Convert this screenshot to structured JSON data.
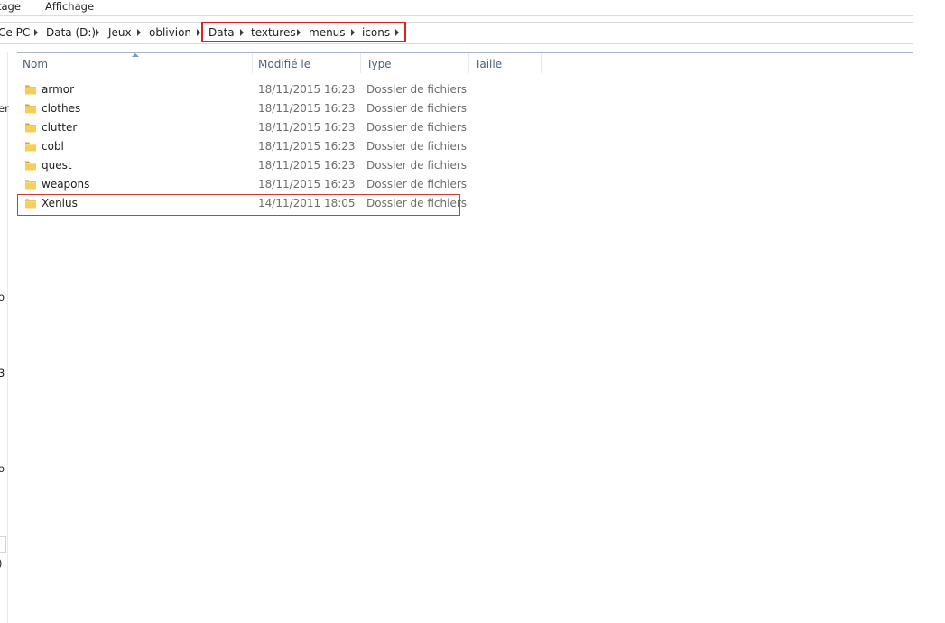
{
  "ribbon": {
    "tabs": [
      "tage",
      "Affichage"
    ]
  },
  "address": {
    "crumbs": [
      "Ce PC",
      "Data (D:)",
      "Jeux",
      "oblivion",
      "Data",
      "textures",
      "menus",
      "icons"
    ]
  },
  "left_pane": {
    "fragments": [
      "er",
      "o",
      "3",
      "o",
      ")"
    ]
  },
  "columns": {
    "name": "Nom",
    "modified": "Modifié le",
    "type": "Type",
    "size": "Taille"
  },
  "files": [
    {
      "name": "armor",
      "modified": "18/11/2015 16:23",
      "type": "Dossier de fichiers",
      "icon": "folder-icon"
    },
    {
      "name": "clothes",
      "modified": "18/11/2015 16:23",
      "type": "Dossier de fichiers",
      "icon": "folder-icon"
    },
    {
      "name": "clutter",
      "modified": "18/11/2015 16:23",
      "type": "Dossier de fichiers",
      "icon": "folder-icon"
    },
    {
      "name": "cobl",
      "modified": "18/11/2015 16:23",
      "type": "Dossier de fichiers",
      "icon": "folder-icon"
    },
    {
      "name": "quest",
      "modified": "18/11/2015 16:23",
      "type": "Dossier de fichiers",
      "icon": "folder-icon"
    },
    {
      "name": "weapons",
      "modified": "18/11/2015 16:23",
      "type": "Dossier de fichiers",
      "icon": "folder-icon"
    },
    {
      "name": "Xenius",
      "modified": "14/11/2011 18:05",
      "type": "Dossier de fichiers",
      "icon": "folder-icon"
    }
  ],
  "colors": {
    "annotation_red": "#e02020",
    "header_text": "#4c607a",
    "folder_yellow": "#e8c04a"
  }
}
